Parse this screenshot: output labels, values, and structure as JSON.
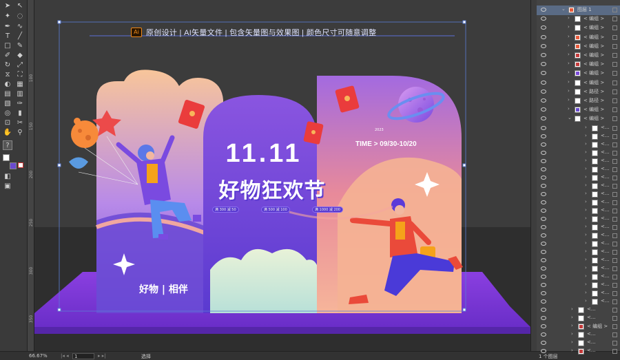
{
  "status_bar": {
    "zoom": "66.67%",
    "artboard": "1",
    "tool": "选择",
    "layer_count": "1 个图层"
  },
  "top_banner": {
    "ai_badge": "Ai",
    "text": "原创设计 | AI矢量文件 | 包含矢量图与效果图 | 颜色尺寸可随意调整"
  },
  "design": {
    "big_title": "11.11",
    "subtitle": "好物狂欢节",
    "year": "2023",
    "time_label": "TIME > 09/30-10/20",
    "coupons": [
      "满 300 减 50",
      "满 500 减 100",
      "满 1000 减 200"
    ],
    "bottom_slogan": "好物 | 相伴"
  },
  "layers": {
    "top_layer": "图层 1",
    "rows": [
      {
        "name": "< 编组 >",
        "color": "#ffffff"
      },
      {
        "name": "< 编组 >",
        "color": "#ffffff"
      },
      {
        "name": "< 编组 >",
        "color": "#e85a3a"
      },
      {
        "name": "< 编组 >",
        "color": "#e85a3a"
      },
      {
        "name": "< 编组 >",
        "color": "#c43a3a"
      },
      {
        "name": "< 编组 >",
        "color": "#c43a3a"
      },
      {
        "name": "< 编组 >",
        "color": "#7a4ad8"
      },
      {
        "name": "< 编组 >",
        "color": "#ffffff"
      },
      {
        "name": "< 路径 >",
        "color": "#ffffff"
      },
      {
        "name": "< 路径 >",
        "color": "#ffffff"
      },
      {
        "name": "< 编组 >",
        "color": "#6a4ad0"
      },
      {
        "name": "< 编组 >",
        "color": "#ffffff"
      }
    ],
    "sub_rows": [
      "<...",
      "<...",
      "<...",
      "<...",
      "<...",
      "<...",
      "<...",
      "<...",
      "<...",
      "<...",
      "<...",
      "<...",
      "<...",
      "<...",
      "<...",
      "<...",
      "<...",
      "<...",
      "<...",
      "<...",
      "<...",
      "<..."
    ],
    "bottom_rows": [
      {
        "name": "<...",
        "color": "#ffffff"
      },
      {
        "name": "<...",
        "color": "#ffffff"
      },
      {
        "name": "< 编组 >",
        "color": "#c43a3a"
      },
      {
        "name": "<...",
        "color": "#ffffff"
      },
      {
        "name": "<...",
        "color": "#ffffff"
      },
      {
        "name": "<...",
        "color": "#c43a3a"
      }
    ]
  },
  "ruler_marks": [
    "100",
    "150",
    "200",
    "250",
    "300",
    "350"
  ]
}
